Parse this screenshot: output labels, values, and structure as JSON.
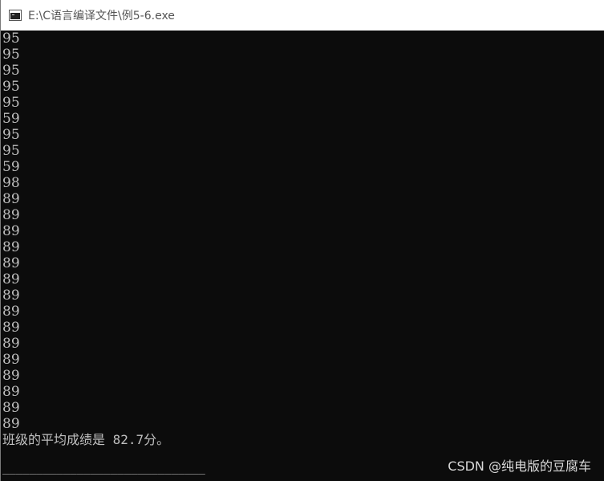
{
  "window": {
    "title": "E:\\C语言编译文件\\例5-6.exe",
    "app_icon": "console-icon"
  },
  "console": {
    "lines": [
      "95",
      "95",
      "95",
      "95",
      "95",
      "59",
      "95",
      "95",
      "59",
      "98",
      "89",
      "89",
      "89",
      "89",
      "89",
      "89",
      "89",
      "89",
      "89",
      "89",
      "89",
      "89",
      "89",
      "89",
      "89"
    ],
    "average_line": "班级的平均成绩是 82.7分。",
    "underline": "______________________________"
  },
  "watermark": "CSDN @纯电版的豆腐车",
  "colors": {
    "console_bg": "#0c0c0c",
    "console_fg": "#c0c0c0",
    "titlebar_bg": "#ffffff"
  }
}
